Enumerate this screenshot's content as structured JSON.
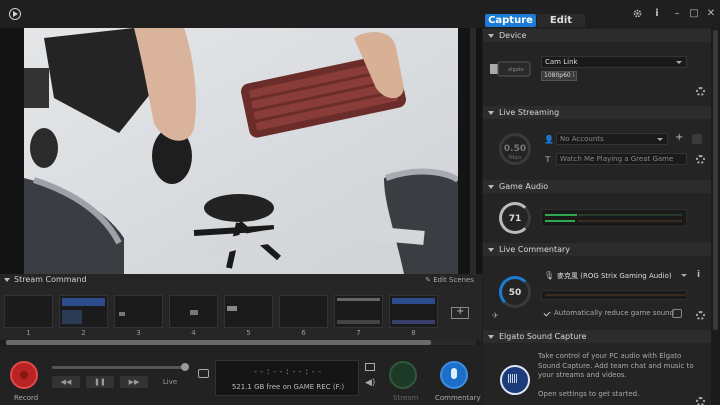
{
  "tabs": {
    "capture": "Capture",
    "edit": "Edit"
  },
  "window": {
    "settings_icon": "gear-icon",
    "info_icon": "info-icon",
    "minimize": "–",
    "maximize": "□",
    "close": "✕",
    "info_glyph": "i"
  },
  "stream_command": {
    "title": "Stream Command",
    "edit_scenes": "Edit Scenes",
    "scenes": [
      {
        "number": "1"
      },
      {
        "number": "2"
      },
      {
        "number": "3"
      },
      {
        "number": "4"
      },
      {
        "number": "5"
      },
      {
        "number": "6"
      },
      {
        "number": "7"
      },
      {
        "number": "8"
      }
    ]
  },
  "controls": {
    "record_label": "Record",
    "live_label": "Live",
    "rewind": "◀◀",
    "pause": "❚❚",
    "forward": "▶▶",
    "timecode": "--:--:--:--",
    "disk_free": "521.1 GB free on GAME REC (F:)",
    "stream_label": "Stream",
    "commentary_label": "Commentary"
  },
  "device": {
    "title": "Device",
    "selected": "Cam Link",
    "resolution": "1080p60",
    "resolution_info": "i"
  },
  "live_streaming": {
    "title": "Live Streaming",
    "bitrate": "0.50",
    "bitrate_unit": "Mbps",
    "accounts_placeholder": "No Accounts",
    "add": "+",
    "stream_title": "Watch Me Playing a Great Game"
  },
  "game_audio": {
    "title": "Game Audio",
    "volume": "71"
  },
  "live_commentary": {
    "title": "Live Commentary",
    "volume": "50",
    "mic": "麥克風 (ROG Strix Gaming Audio)",
    "mic_info": "i",
    "auto_reduce": "Automatically reduce game sound"
  },
  "sound_capture": {
    "title": "Elgato Sound Capture",
    "description": "Take control of your PC audio with Elgato Sound Capture. Add team chat and music to your streams and videos.",
    "link": "Open settings to get started."
  },
  "colors": {
    "accent": "#1c7bd6",
    "record": "#b92323",
    "meter_green": "#2fa84f"
  }
}
